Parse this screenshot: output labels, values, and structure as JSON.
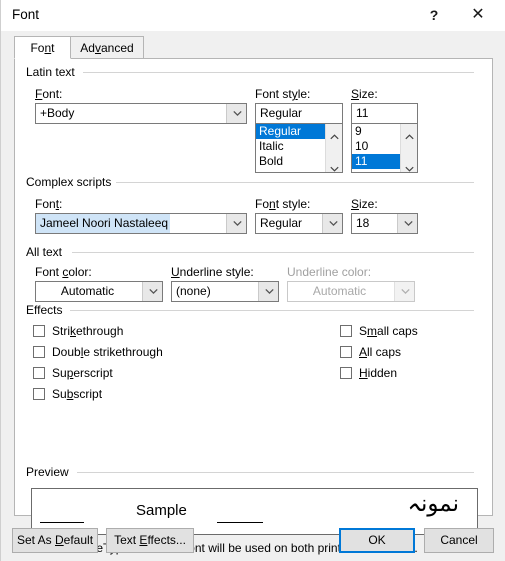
{
  "window": {
    "title": "Font",
    "help_icon": "question-mark-icon",
    "close_icon": "close-icon"
  },
  "tabs": [
    {
      "label": "Font",
      "accel": "n",
      "active": true
    },
    {
      "label": "Advanced",
      "accel": "v",
      "active": false
    }
  ],
  "latin_text": {
    "group_label": "Latin text",
    "font": {
      "label": "Font:",
      "accel": "F",
      "value": "+Body"
    },
    "font_style": {
      "label": "Font style:",
      "accel": "y",
      "value": "Regular",
      "options": [
        "Regular",
        "Italic",
        "Bold"
      ],
      "selected": "Regular"
    },
    "size": {
      "label": "Size:",
      "accel": "S",
      "value": "11",
      "options": [
        "9",
        "10",
        "11"
      ],
      "selected": "11"
    }
  },
  "complex_scripts": {
    "group_label": "Complex scripts",
    "font": {
      "label": "Font:",
      "accel": "t",
      "value": "Jameel Noori Nastaleeq"
    },
    "font_style": {
      "label": "Font style:",
      "accel": "n",
      "value": "Regular"
    },
    "size": {
      "label": "Size:",
      "accel": "S",
      "value": "18"
    }
  },
  "all_text": {
    "group_label": "All text",
    "font_color": {
      "label": "Font color:",
      "accel": "c",
      "value": "Automatic"
    },
    "underline_style": {
      "label": "Underline style:",
      "accel": "U",
      "value": "(none)"
    },
    "underline_color": {
      "label": "Underline color:",
      "value": "Automatic",
      "disabled": true
    }
  },
  "effects": {
    "group_label": "Effects",
    "left": [
      {
        "label": "Strikethrough",
        "accel": "k",
        "checked": false
      },
      {
        "label": "Double strikethrough",
        "accel": "l",
        "checked": false
      },
      {
        "label": "Superscript",
        "accel": "p",
        "checked": false
      },
      {
        "label": "Subscript",
        "accel": "b",
        "checked": false
      }
    ],
    "right": [
      {
        "label": "Small caps",
        "accel": "m",
        "checked": false
      },
      {
        "label": "All caps",
        "accel": "A",
        "checked": false
      },
      {
        "label": "Hidden",
        "accel": "H",
        "checked": false
      }
    ]
  },
  "preview": {
    "group_label": "Preview",
    "sample_text": "Sample",
    "complex_sample_text": "نمونہ",
    "note": "This is a TrueType font. This font will be used on both printer and screen."
  },
  "footer": {
    "set_as_default": "Set As Default",
    "set_as_default_accel": "D",
    "text_effects": "Text Effects...",
    "text_effects_accel": "E",
    "ok": "OK",
    "cancel": "Cancel"
  },
  "colors": {
    "selection_blue": "#0078d7",
    "field_selection": "#cfe4f7",
    "dialog_bg": "#f0f0f0",
    "panel_bg": "#ffffff",
    "disabled_text": "#a0a0a0"
  }
}
